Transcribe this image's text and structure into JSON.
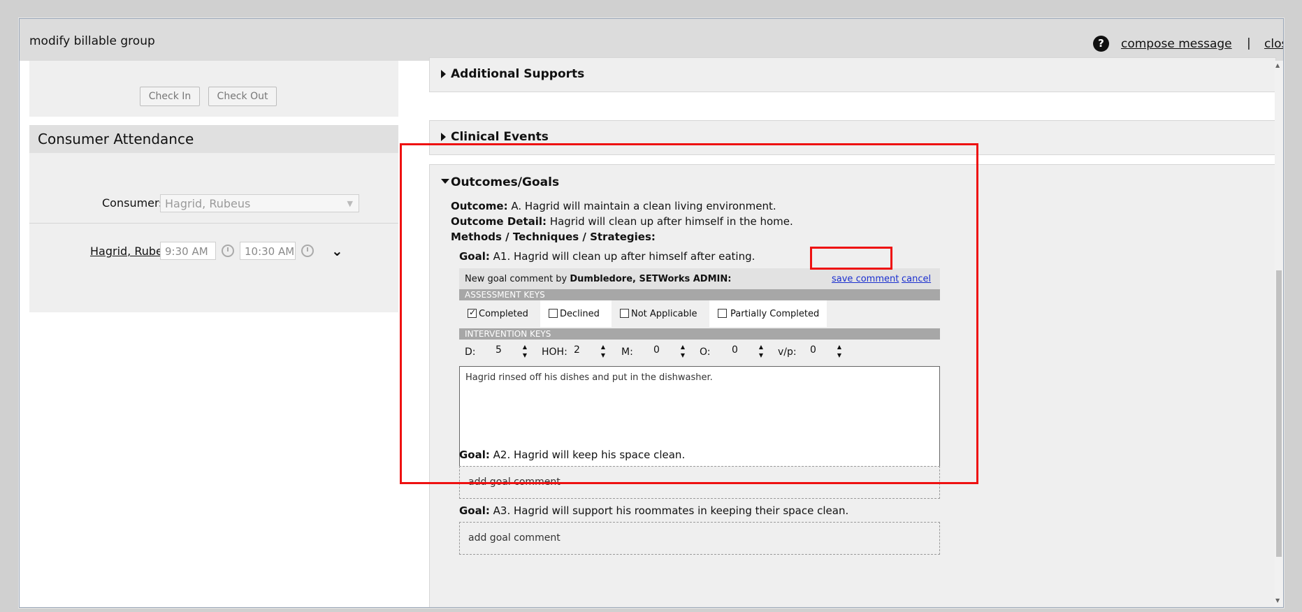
{
  "window": {
    "title": "modify billable group",
    "help_label": "?",
    "compose_label": "compose message",
    "separator": "|",
    "close_label": "close"
  },
  "attendance_buttons": {
    "check_in": "Check In",
    "check_out": "Check Out"
  },
  "consumer_attendance": {
    "title": "Consumer Attendance",
    "consumers_label": "Consumers:",
    "consumers_value": "Hagrid, Rubeus",
    "entry": {
      "name": "Hagrid, Rubeus",
      "time_in": "9:30 AM",
      "time_out": "10:30 AM"
    }
  },
  "sections": {
    "additional_supports": "Additional Supports",
    "clinical_events": "Clinical Events",
    "outcomes_goals": "Outcomes/Goals"
  },
  "outcome": {
    "outcome_label": "Outcome:",
    "outcome_value": "A. Hagrid will maintain a clean living environment.",
    "detail_label": "Outcome Detail:",
    "detail_value": "Hagrid will clean up after himself in the home.",
    "methods_label": "Methods / Techniques / Strategies:"
  },
  "goals": [
    {
      "label": "Goal:",
      "text": "A1. Hagrid will clean up after himself after eating."
    },
    {
      "label": "Goal:",
      "text": "A2. Hagrid will keep his space clean.",
      "add_comment": "add goal comment"
    },
    {
      "label": "Goal:",
      "text": "A3. Hagrid will support his roommates in keeping their space clean.",
      "add_comment": "add goal comment"
    }
  ],
  "comment_form": {
    "header_prefix": "New goal comment by ",
    "author": "Dumbledore, SETWorks ADMIN:",
    "save_label": "save comment",
    "cancel_label": "cancel",
    "assessment_title": "ASSESSMENT KEYS",
    "assessment_keys": [
      {
        "label": "Completed",
        "checked": true
      },
      {
        "label": "Declined",
        "checked": false
      },
      {
        "label": "Not Applicable",
        "checked": false
      },
      {
        "label": "Partially Completed",
        "checked": false
      }
    ],
    "intervention_title": "INTERVENTION KEYS",
    "intervention_keys": [
      {
        "label": "D:",
        "value": "5"
      },
      {
        "label": "HOH:",
        "value": "2"
      },
      {
        "label": "M:",
        "value": "0"
      },
      {
        "label": "O:",
        "value": "0"
      },
      {
        "label": "v/p:",
        "value": "0"
      }
    ],
    "comment_text": "Hagrid rinsed off his dishes and put in the dishwasher."
  },
  "highlight_color": "#ee1111",
  "link_color": "#1a2fcf"
}
